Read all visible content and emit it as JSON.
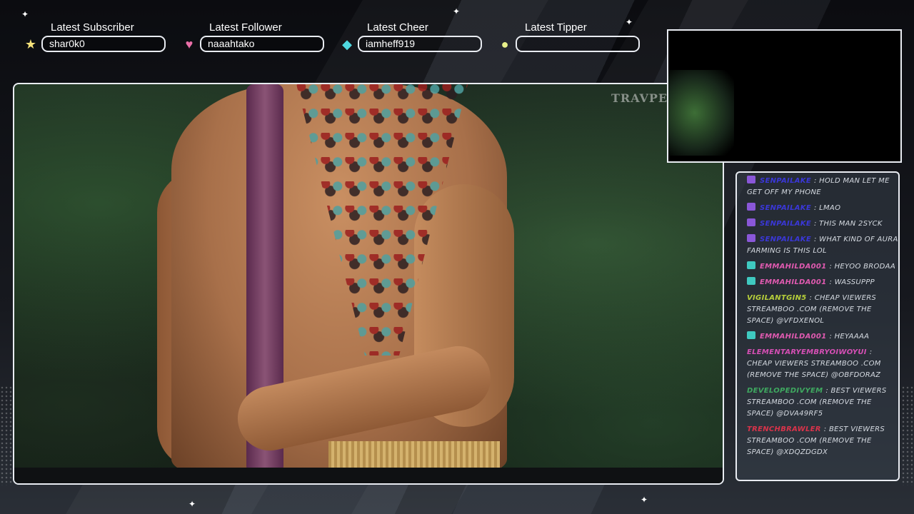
{
  "alerts": [
    {
      "label": "Latest Subscriber",
      "value": "shar0k0",
      "icon": "star-icon",
      "color": "#f5e27a",
      "glyph": "★"
    },
    {
      "label": "Latest Follower",
      "value": "naaahtako",
      "icon": "heart-icon",
      "color": "#ea6fa8",
      "glyph": "♥"
    },
    {
      "label": "Latest Cheer",
      "value": "iamheff919",
      "icon": "gem-icon",
      "color": "#4fd9e0",
      "glyph": "◆"
    },
    {
      "label": "Latest Tipper",
      "value": "",
      "icon": "coin-icon",
      "color": "#e8f08a",
      "glyph": "●"
    }
  ],
  "video": {
    "watermark": "TRAVPEDIA"
  },
  "chat": {
    "messages": [
      {
        "user": "senpailake",
        "user_color": "#3a37d8",
        "text": "hold man let me get off my phone",
        "badge": "sub-badge-icon",
        "badge_color": "#8a57d8"
      },
      {
        "user": "senpailake",
        "user_color": "#3a37d8",
        "text": "lmao",
        "badge": "sub-badge-icon",
        "badge_color": "#8a57d8"
      },
      {
        "user": "senpailake",
        "user_color": "#3a37d8",
        "text": "this man 2syck",
        "badge": "sub-badge-icon",
        "badge_color": "#8a57d8"
      },
      {
        "user": "senpailake",
        "user_color": "#3a37d8",
        "text": "what kind of aura farming is this lol",
        "badge": "sub-badge-icon",
        "badge_color": "#8a57d8"
      },
      {
        "user": "emmahilda001",
        "user_color": "#e05ab0",
        "text": "heyoo brodaa",
        "badge": "gem-badge-icon",
        "badge_color": "#3fc9c0"
      },
      {
        "user": "emmahilda001",
        "user_color": "#e05ab0",
        "text": "wassuppp",
        "badge": "gem-badge-icon",
        "badge_color": "#3fc9c0"
      },
      {
        "user": "vigilantgin5",
        "user_color": "#b8d03a",
        "text": "Cheap viewers streamboo .com (remove the space) @vFdxenoL",
        "badge": "",
        "badge_color": ""
      },
      {
        "user": "emmahilda001",
        "user_color": "#e05ab0",
        "text": "Heyaaaa",
        "badge": "gem-badge-icon",
        "badge_color": "#3fc9c0"
      },
      {
        "user": "elementaryembryoiwoyui",
        "user_color": "#d64fb5",
        "text": "Cheap viewers streamboo .com (remove the space) @oBFdoRaZ",
        "badge": "",
        "badge_color": ""
      },
      {
        "user": "developedivyem",
        "user_color": "#3fa860",
        "text": "Best viewers streamboo .com (remove the space) @dva49Rf5",
        "badge": "",
        "badge_color": ""
      },
      {
        "user": "trenchbrawler",
        "user_color": "#d9334a",
        "text": "Best viewers streamboo .com (remove the space) @XDQzDGdx",
        "badge": "",
        "badge_color": ""
      }
    ]
  }
}
